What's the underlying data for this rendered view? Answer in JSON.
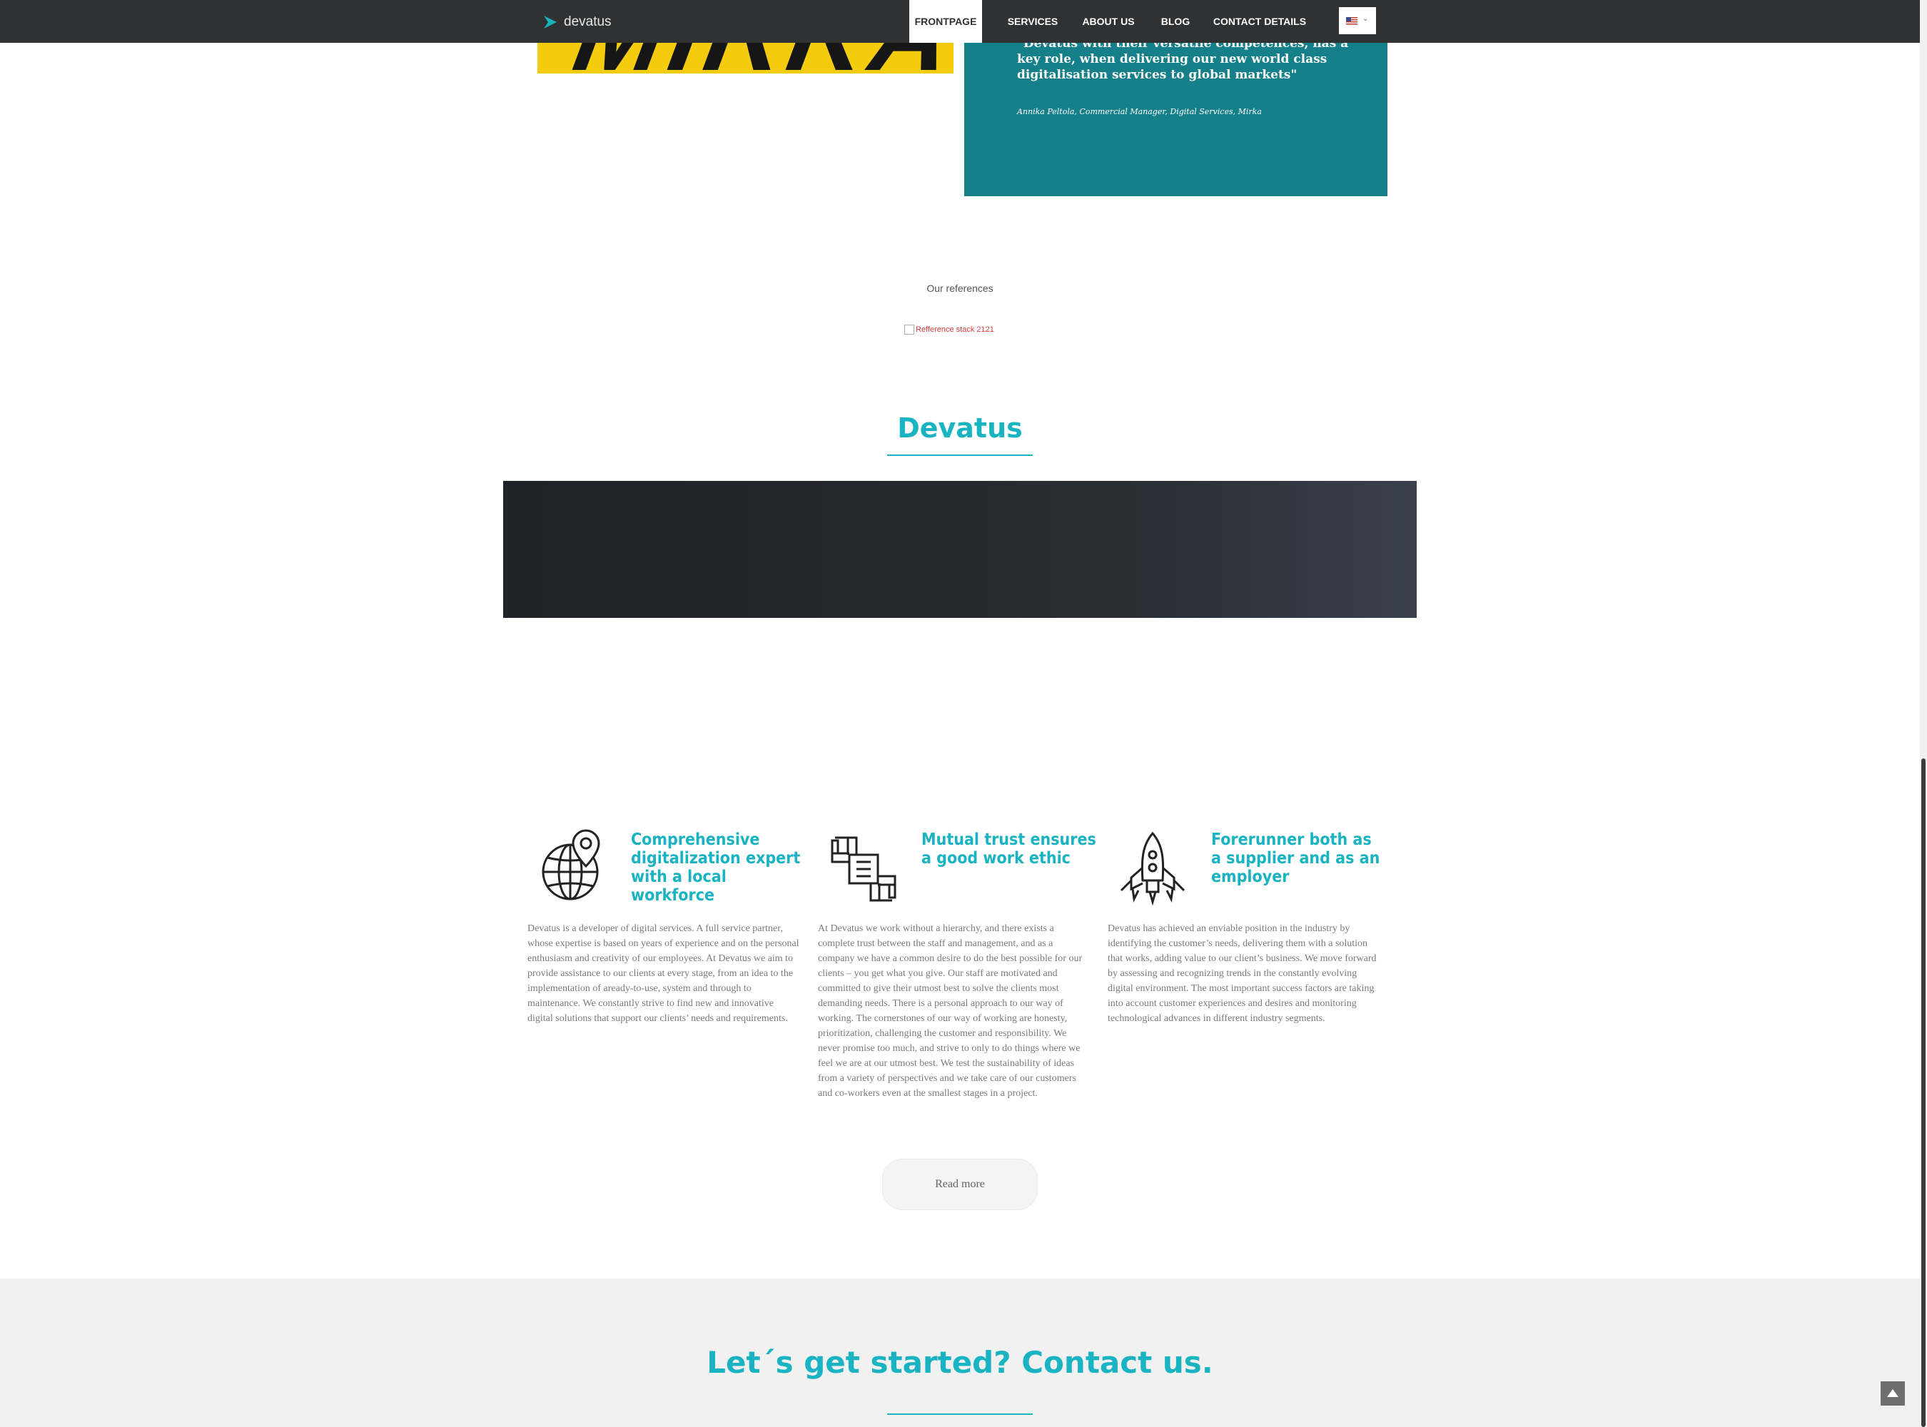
{
  "nav": {
    "logo_text": "devatus",
    "items": [
      {
        "label": "FRONTPAGE",
        "active": true
      },
      {
        "label": "SERVICES",
        "active": false
      },
      {
        "label": "ABOUT US",
        "active": false
      },
      {
        "label": "BLOG",
        "active": false
      },
      {
        "label": "CONTACT DETAILS",
        "active": false
      }
    ],
    "language_flag_icon": "us-flag-icon"
  },
  "testimonial": {
    "logo_text": "MIRKA",
    "quote": "\"Devatus with their versatile competences, has a key role, when delivering our new world class digitalisation services to global markets\"",
    "author": "Annika Peltola, Commercial Manager, Digital Services, Mirka"
  },
  "references": {
    "title": "Our references",
    "image_alt": "Refference stack 2121"
  },
  "about": {
    "title": "Devatus",
    "features": [
      {
        "icon": "globe-location-icon",
        "title": "Comprehensive digitalization expert with a local workforce",
        "text": "Devatus is a developer of digital services. A full service partner, whose expertise is based on years of experience and on the personal enthusiasm and creativity of our employees. At Devatus we aim to provide assistance to our clients at every stage, from an idea to the implementation of aready-to-use, system and through to maintenance. We constantly strive to find new and innovative digital solutions that support our clients’ needs and requirements."
      },
      {
        "icon": "joined-hands-icon",
        "title": "Mutual trust ensures a good work ethic",
        "text": "At Devatus we work without a hierarchy, and there exists a complete trust between the staff and management, and as a company we have a common desire to do the best possible for our clients – you get what you give. Our staff are motivated and committed to give their utmost best to solve the clients most demanding needs. There is a personal approach to our way of working. The cornerstones of our way of working are honesty, prioritization, challenging the customer and responsibility. We never promise too much, and strive to only to do things where we feel we are at our utmost best. We test the sustainability of ideas from a variety of perspectives and we take care of our customers and co-workers even at the smallest stages in a project."
      },
      {
        "icon": "rocket-icon",
        "title": "Forerunner both as a supplier and as an employer",
        "text": "Devatus has achieved an enviable position in the industry by identifying the customer’s needs, delivering them with a solution that works, adding value to our client’s business. We move forward by assessing and recognizing trends in the constantly evolving digital environment. The most important success factors are taking into account customer experiences and desires and monitoring technological advances in different industry segments."
      }
    ],
    "read_more_label": "Read more"
  },
  "contact": {
    "title": "Let´s get started? Contact us."
  },
  "colors": {
    "accent": "#1ab3c1",
    "navbar": "#2f3133",
    "testimonial_bg": "#16808a",
    "mirka_yellow": "#f3cc0e"
  }
}
